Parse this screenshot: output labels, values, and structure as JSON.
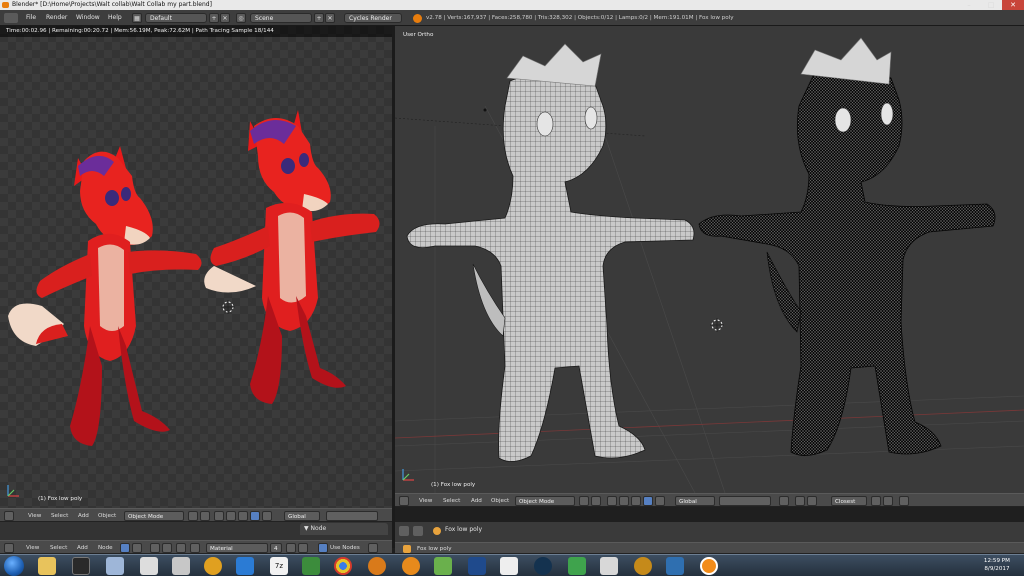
{
  "window": {
    "title": "Blender* [D:\\Home\\Projects\\Walt collab\\Walt Collab my part.blend]",
    "minimize": "–",
    "maximize": "□",
    "close": "✕"
  },
  "infobar": {
    "menus": [
      "File",
      "Render",
      "Window",
      "Help"
    ],
    "layout": "Default",
    "scene": "Scene",
    "engine": "Cycles Render",
    "stats": "v2.78 | Verts:167,937 | Faces:258,780 | Tris:328,302 | Objects:0/12 | Lamps:0/2 | Mem:191.01M | Fox low poly"
  },
  "left_viewport": {
    "render_status": "Time:00:02.96 | Remaining:00:20.72 | Mem:56.19M, Peak:72.62M | Path Tracing Sample 18/144",
    "object_label": "(1) Fox low poly",
    "header": {
      "menus": [
        "View",
        "Select",
        "Add",
        "Object"
      ],
      "mode": "Object Mode",
      "orientation": "Global"
    }
  },
  "right_viewport": {
    "view_label": "User Ortho",
    "object_label": "(1) Fox low poly",
    "header": {
      "menus": [
        "View",
        "Select",
        "Add",
        "Object"
      ],
      "mode": "Object Mode",
      "orientation": "Global",
      "snap": "Closest"
    }
  },
  "node_editor": {
    "menus": [
      "View",
      "Select",
      "Add",
      "Node"
    ],
    "material": "Material",
    "users": "4",
    "use_nodes": "Use Nodes",
    "panel_tab": "Node"
  },
  "properties": {
    "object_name": "Fox low poly",
    "bottom_object": "Fox low poly"
  },
  "taskbar": {
    "time": "12:59 PM",
    "date": "8/9/2017",
    "icons": [
      "explorer-icon",
      "notes-icon",
      "media-icon",
      "doc-icon",
      "zbrush-icon",
      "headphones-icon",
      "edge-icon",
      "sevenzip-icon",
      "tool-icon",
      "chrome-icon",
      "unity-icon",
      "firefox-icon",
      "paint-icon",
      "photoshop-icon",
      "media-player-icon",
      "steam-icon",
      "app-icon",
      "game-icon",
      "app2-icon",
      "media2-icon",
      "blender-icon"
    ]
  },
  "colors": {
    "accent": "#5680c2",
    "blender_orange": "#e87d0d",
    "fox_red": "#e81a1a"
  }
}
